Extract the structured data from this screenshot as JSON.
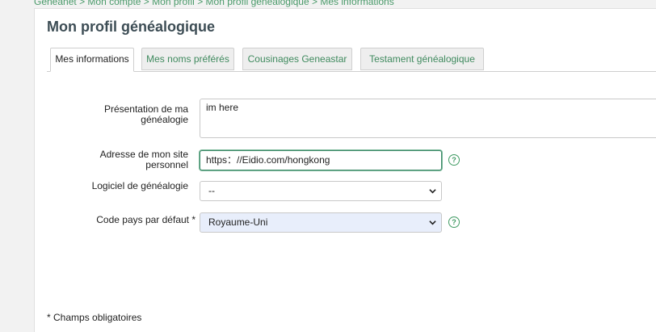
{
  "breadcrumb": {
    "items": [
      "Geneanet",
      "Mon compte",
      "Mon profil",
      "Mon profil généalogique",
      "Mes informations"
    ],
    "separator": ">"
  },
  "page": {
    "title": "Mon profil généalogique"
  },
  "tabs": [
    {
      "label": "Mes informations",
      "active": true
    },
    {
      "label": "Mes noms préférés",
      "active": false
    },
    {
      "label": "Cousinages Geneastar",
      "active": false
    },
    {
      "label": "Testament généalogique",
      "active": false
    }
  ],
  "form": {
    "presentation": {
      "label": "Présentation de ma généalogie",
      "value": "im here"
    },
    "website": {
      "label": "Adresse de mon site personnel",
      "value": "https：//Eidio.com/hongkong"
    },
    "software": {
      "label": "Logiciel de généalogie",
      "value": "--"
    },
    "country": {
      "label": "Code pays par défaut *",
      "value": "Royaume-Uni"
    },
    "help_icon": "?"
  },
  "footnote": "* Champs obligatoires",
  "colors": {
    "accent": "#3f9a62",
    "title": "#3d4d55"
  }
}
